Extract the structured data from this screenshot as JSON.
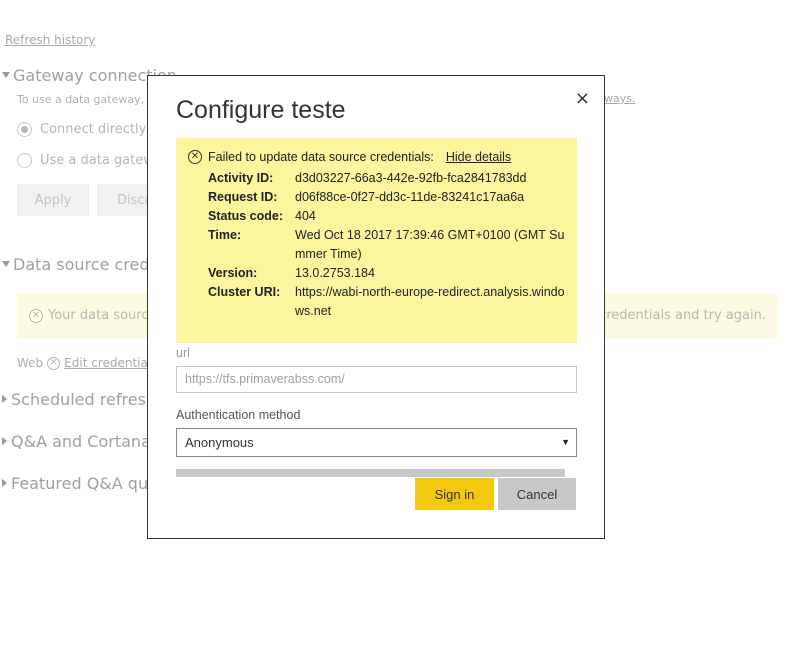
{
  "background": {
    "refresh_history": "Refresh history",
    "gateway_heading": "Gateway connection",
    "gateway_desc": "To use a data gateway,",
    "gateway_link_tail": "ways.",
    "radio_direct": "Connect directly",
    "radio_gateway": "Use a data gatew",
    "apply_label": "Apply",
    "discard_label": "Disca",
    "credentials_heading": "Data source crede",
    "warn_left": "Your data source",
    "warn_right": "r credentials and try again.",
    "web_label": "Web",
    "edit_credentials": "Edit credential",
    "scheduled_refresh": "Scheduled refresh",
    "qa_cortana": "Q&A and Cortana",
    "featured_qa": "Featured Q&A que"
  },
  "modal": {
    "title": "Configure teste",
    "close": "×",
    "error": {
      "message": "Failed to update data source credentials:",
      "hide_details": "Hide details",
      "rows": [
        {
          "key": "Activity ID:",
          "value": "d3d03227-66a3-442e-92fb-fca2841783dd"
        },
        {
          "key": "Request ID:",
          "value": "d06f88ce-0f27-dd3c-11de-83241c17aa6a"
        },
        {
          "key": "Status code:",
          "value": "404"
        },
        {
          "key": "Time:",
          "value": "Wed Oct 18 2017 17:39:46 GMT+0100 (GMT Summer Time)"
        },
        {
          "key": "Version:",
          "value": "13.0.2753.184"
        },
        {
          "key": "Cluster URI:",
          "value": "https://wabi-north-europe-redirect.analysis.windows.net"
        }
      ]
    },
    "url_label": "url",
    "url_placeholder": "https://tfs.primaverabss.com/",
    "auth_label": "Authentication method",
    "auth_value": "Anonymous",
    "signin_label": "Sign in",
    "cancel_label": "Cancel"
  },
  "colors": {
    "error_bg": "#fbf59e",
    "signin_bg": "#f2c811",
    "cancel_bg": "#c8c8c8"
  }
}
